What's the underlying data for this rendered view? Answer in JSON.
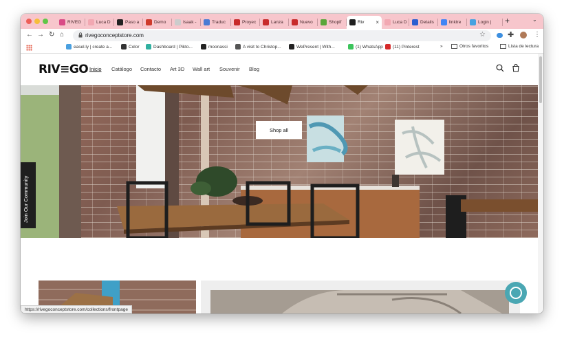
{
  "browser": {
    "tabs": [
      {
        "label": "RIVEG",
        "color": "#d94b86"
      },
      {
        "label": "Luca D",
        "color": "#f2a8b2"
      },
      {
        "label": "Paso a",
        "color": "#222222"
      },
      {
        "label": "Demo",
        "color": "#cf3a2b"
      },
      {
        "label": "Isaak -",
        "color": "#cccccc"
      },
      {
        "label": "Traduc",
        "color": "#4a7bd4"
      },
      {
        "label": "Proyec",
        "color": "#c82a2a"
      },
      {
        "label": "Lanza",
        "color": "#c82a2a"
      },
      {
        "label": "Nuevo",
        "color": "#c82a2a"
      },
      {
        "label": "Shopif",
        "color": "#5aa63a"
      },
      {
        "label": "Riv",
        "color": "#1f1f1f"
      },
      {
        "label": "Luca D",
        "color": "#f2a8b2"
      },
      {
        "label": "Details",
        "color": "#2b5fd0"
      },
      {
        "label": "linktre",
        "color": "#4285f4"
      },
      {
        "label": "Login |",
        "color": "#47a2e0"
      }
    ],
    "active_tab_index": 10,
    "new_tab_symbol": "+",
    "tab_menu_symbol": "⌄",
    "url": "rivegoconceptstore.com",
    "bookmarks": [
      {
        "label": "easel.ly | create a...",
        "color": "#4aa0e0"
      },
      {
        "label": "Color",
        "color": "#333333"
      },
      {
        "label": "Dashboard | Pikto...",
        "color": "#30b0a0"
      },
      {
        "label": "moonassi",
        "color": "#222222"
      },
      {
        "label": "A visit to Christop...",
        "color": "#555555"
      },
      {
        "label": "WePresent | With...",
        "color": "#222222"
      },
      {
        "label": "(1) WhatsApp",
        "color": "#3cc45c"
      },
      {
        "label": "(11) Pinterest",
        "color": "#d62a2a"
      }
    ],
    "bookmarks_more": "»",
    "other_bookmarks": "Otros favoritos",
    "reading_list": "Lista de lectura",
    "status_url": "https://rivegoconceptstore.com/collections/frontpage"
  },
  "site": {
    "logo": "RIV≡GO",
    "nav": [
      "Inicio",
      "Catálogo",
      "Contacto",
      "Art 3D",
      "Wall art",
      "Souvenir",
      "Blog"
    ],
    "active_nav_index": 0,
    "hero_button": "Shop all",
    "community_tab": "Join Our Community",
    "accent_color": "#4aa7b3"
  }
}
